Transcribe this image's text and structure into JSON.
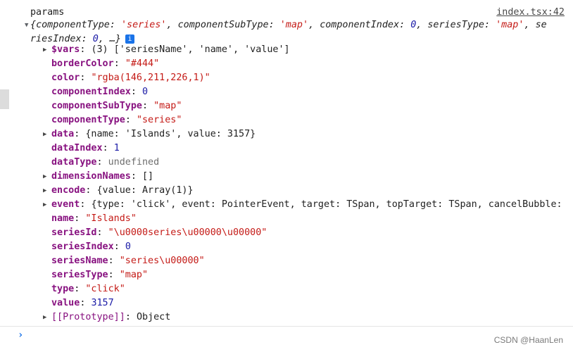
{
  "log": {
    "label": "params",
    "source": "index.tsx:42",
    "summary_line1_prefix": "{",
    "summary": {
      "k1": "componentType",
      "v1": "'series'",
      "k2": "componentSubType",
      "v2": "'map'",
      "k3": "componentIndex",
      "v3": "0",
      "k4": "seriesType",
      "v4": "'map'",
      "k5a": "se",
      "k5b": "riesIndex",
      "v5": "0",
      "tail": ", …}"
    },
    "info_badge": "i"
  },
  "props": [
    {
      "key": "$vars",
      "value": "(3) ['seriesName', 'name', 'value']",
      "kind": "obj",
      "expandable": true
    },
    {
      "key": "borderColor",
      "value": "\"#444\"",
      "kind": "str",
      "expandable": false
    },
    {
      "key": "color",
      "value": "\"rgba(146,211,226,1)\"",
      "kind": "str",
      "expandable": false
    },
    {
      "key": "componentIndex",
      "value": "0",
      "kind": "num",
      "expandable": false
    },
    {
      "key": "componentSubType",
      "value": "\"map\"",
      "kind": "str",
      "expandable": false
    },
    {
      "key": "componentType",
      "value": "\"series\"",
      "kind": "str",
      "expandable": false
    },
    {
      "key": "data",
      "value": "{name: 'Islands', value: 3157}",
      "kind": "obj",
      "expandable": true
    },
    {
      "key": "dataIndex",
      "value": "1",
      "kind": "num",
      "expandable": false
    },
    {
      "key": "dataType",
      "value": "undefined",
      "kind": "undef",
      "expandable": false
    },
    {
      "key": "dimensionNames",
      "value": "[]",
      "kind": "obj",
      "expandable": true
    },
    {
      "key": "encode",
      "value": "{value: Array(1)}",
      "kind": "obj",
      "expandable": true
    },
    {
      "key": "event",
      "value": "{type: 'click', event: PointerEvent, target: TSpan, topTarget: TSpan, cancelBubble:",
      "kind": "obj",
      "expandable": true
    },
    {
      "key": "name",
      "value": "\"Islands\"",
      "kind": "str",
      "expandable": false
    },
    {
      "key": "seriesId",
      "value": "\"\\u0000series\\u00000\\u00000\"",
      "kind": "str",
      "expandable": false
    },
    {
      "key": "seriesIndex",
      "value": "0",
      "kind": "num",
      "expandable": false
    },
    {
      "key": "seriesName",
      "value": "\"series\\u00000\"",
      "kind": "str",
      "expandable": false
    },
    {
      "key": "seriesType",
      "value": "\"map\"",
      "kind": "str",
      "expandable": false
    },
    {
      "key": "type",
      "value": "\"click\"",
      "kind": "str",
      "expandable": false
    },
    {
      "key": "value",
      "value": "3157",
      "kind": "num",
      "expandable": false
    },
    {
      "key": "[[Prototype]]",
      "value": "Object",
      "kind": "obj",
      "expandable": true,
      "nonenum": true
    }
  ],
  "prompt": {
    "caret": "›"
  },
  "watermark": "CSDN @HaanLen"
}
